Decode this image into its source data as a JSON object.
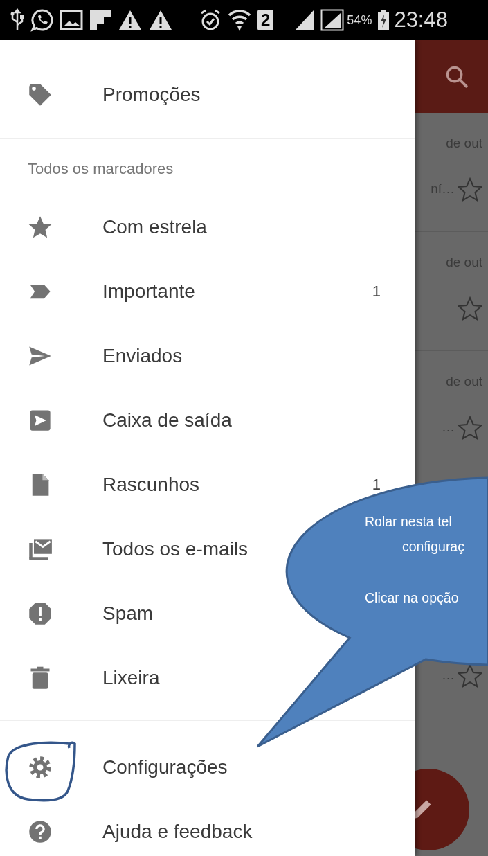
{
  "status_bar": {
    "sim_slot": "2",
    "battery": "54%",
    "time": "23:48"
  },
  "drawer": {
    "top_items": [
      {
        "kind": "tag",
        "label": "Promoções"
      }
    ],
    "section_header": "Todos os marcadores",
    "labels": [
      {
        "kind": "star",
        "label": "Com estrela"
      },
      {
        "kind": "important",
        "label": "Importante",
        "count": "1"
      },
      {
        "kind": "send",
        "label": "Enviados"
      },
      {
        "kind": "outbox",
        "label": "Caixa de saída"
      },
      {
        "kind": "draft",
        "label": "Rascunhos",
        "count": "1"
      },
      {
        "kind": "allmail",
        "label": "Todos os e-mails"
      },
      {
        "kind": "spam",
        "label": "Spam"
      },
      {
        "kind": "trash",
        "label": "Lixeira"
      }
    ],
    "bottom_items": [
      {
        "kind": "settings",
        "label": "Configurações",
        "circled": true
      },
      {
        "kind": "help",
        "label": "Ajuda e feedback",
        "circled": false
      }
    ]
  },
  "inbox_behind": {
    "rows": [
      {
        "date": "de out",
        "snippet": "ní…",
        "starred": false
      },
      {
        "date": "de out",
        "starred": false
      },
      {
        "date": "de out",
        "snippet": "…",
        "starred": false
      },
      {
        "snippet": "…",
        "starred": false
      }
    ]
  },
  "callout": {
    "lines": [
      "Rolar nesta tel",
      "configuraç",
      "Clicar na opção"
    ]
  }
}
